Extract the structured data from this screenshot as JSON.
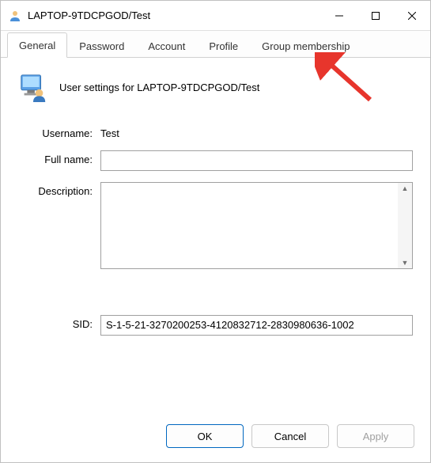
{
  "titlebar": {
    "title": "LAPTOP-9TDCPGOD/Test"
  },
  "tabs": [
    {
      "label": "General",
      "active": true
    },
    {
      "label": "Password",
      "active": false
    },
    {
      "label": "Account",
      "active": false
    },
    {
      "label": "Profile",
      "active": false
    },
    {
      "label": "Group membership",
      "active": false
    }
  ],
  "header": {
    "text": "User settings for LAPTOP-9TDCPGOD/Test"
  },
  "fields": {
    "username_label": "Username:",
    "username_value": "Test",
    "fullname_label": "Full name:",
    "fullname_value": "",
    "description_label": "Description:",
    "description_value": "",
    "sid_label": "SID:",
    "sid_value": "S-1-5-21-3270200253-4120832712-2830980636-1002"
  },
  "buttons": {
    "ok": "OK",
    "cancel": "Cancel",
    "apply": "Apply"
  }
}
